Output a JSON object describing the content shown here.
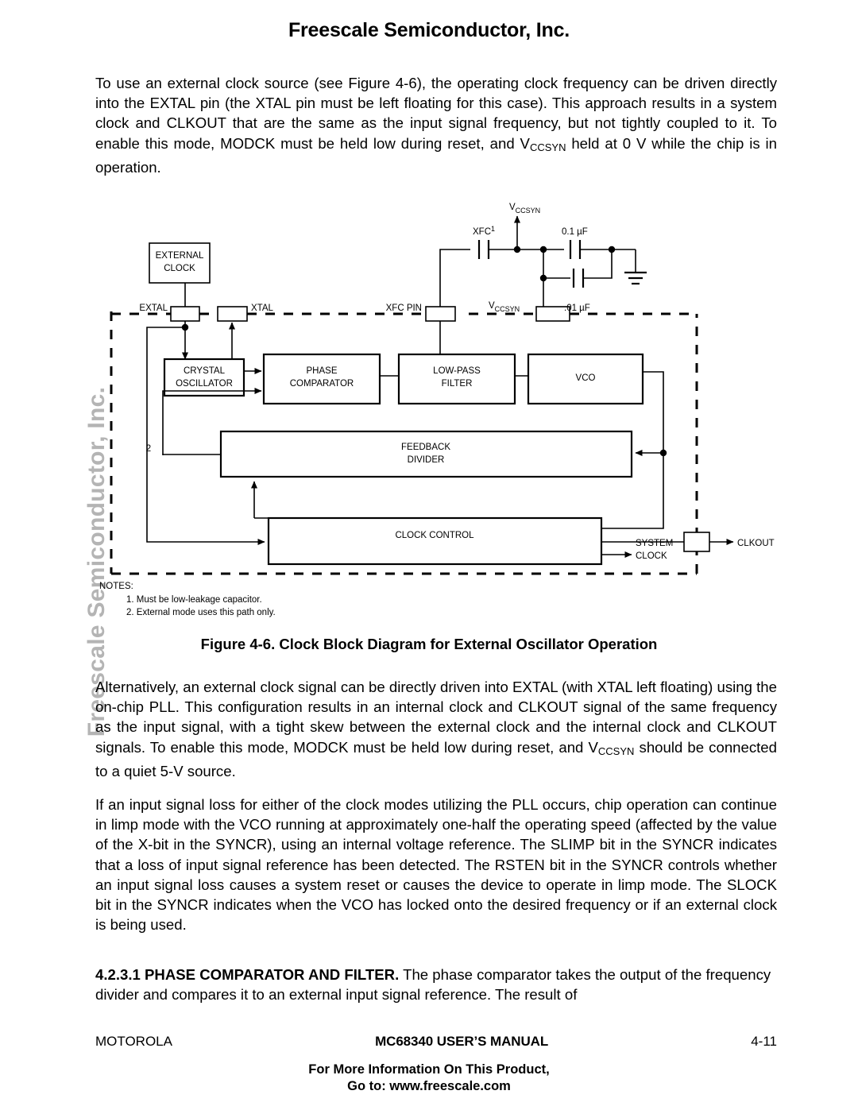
{
  "header": {
    "title": "Freescale Semiconductor, Inc."
  },
  "side_watermark": {
    "text": "Freescale Semiconductor, Inc.",
    "color": "#b4b4b4"
  },
  "paragraphs": {
    "intro_a": "To use an external clock source (see Figure 4-6), the operating clock frequency can be driven directly into the EXTAL pin (the XTAL pin must be left floating for this case). This approach results in a system clock and CLKOUT that are the same as the input signal frequency, but not tightly coupled to it. To enable this mode, MODCK  must be held low during reset, and V",
    "intro_sub": "CCSYN",
    "intro_b": " held at 0 V while the chip is in operation.",
    "alt_a": "Alternatively, an external clock signal can be directly driven into EXTAL (with XTAL left floating) using the on-chip PLL. This configuration results in an internal clock and CLKOUT signal of the same frequency as the input signal, with a tight skew between the external clock and the internal clock and CLKOUT signals. To enable this mode, MODCK must be held low during reset, and V",
    "alt_sub": "CCSYN",
    "alt_b": " should be connected to a quiet 5-V source.",
    "loss": "If an input signal loss for either of the clock modes utilizing the PLL occurs, chip operation can continue in limp mode with the VCO running at approximately one-half the operating speed (affected by the value of the X-bit in the SYNCR), using an internal voltage reference. The SLIMP bit in the SYNCR indicates that a loss of input signal reference has been detected. The RSTEN bit in the SYNCR controls whether an input signal loss causes a system reset or causes the device to operate in limp mode. The SLOCK bit in the SYNCR indicates when the VCO has locked onto the desired frequency or if an external clock is being used.",
    "pc_heading": "4.2.3.1 PHASE COMPARATOR AND FILTER.",
    "pc_body": " The phase comparator takes the output of the frequency divider and compares it to an external input signal reference. The result of"
  },
  "figure": {
    "caption": "Figure 4-6. Clock Block Diagram for External Oscillator Operation",
    "blocks": {
      "external_clock_line1": "EXTERNAL",
      "external_clock_line2": "CLOCK",
      "crystal_osc_line1": "CRYSTAL",
      "crystal_osc_line2": "OSCILLATOR",
      "phase_comp_line1": "PHASE",
      "phase_comp_line2": "COMPARATOR",
      "low_pass_line1": "LOW-PASS",
      "low_pass_line2": "FILTER",
      "vco": "VCO",
      "feedback_line1": "FEEDBACK",
      "feedback_line2": "DIVIDER",
      "clock_control": "CLOCK CONTROL"
    },
    "pin_labels": {
      "extal": "EXTAL",
      "xtal": "XTAL",
      "xfc_pin": "XFC PIN",
      "vccsyn_pin": "V",
      "vccsyn_pin_sub": "CCSYN"
    },
    "net_labels": {
      "vccsyn_supply": "V",
      "vccsyn_supply_sub": "CCSYN",
      "xfc": "XFC",
      "xfc_note": "1",
      "cap_01": "0.1 µF",
      "cap_001": ".01 µF",
      "path_note": "2",
      "system_clock_line1": "SYSTEM",
      "system_clock_line2": "CLOCK",
      "clkout": "CLKOUT"
    },
    "notes": {
      "title": "NOTES:",
      "note1": "1. Must be low-leakage capacitor.",
      "note2": "2. External  mode uses this path only."
    }
  },
  "footer": {
    "left": "MOTOROLA",
    "center": "MC68340 USER’S MANUAL",
    "right": "4-11",
    "note_line1": "For More Information On This Product,",
    "note_line2": "Go to: www.freescale.com"
  }
}
